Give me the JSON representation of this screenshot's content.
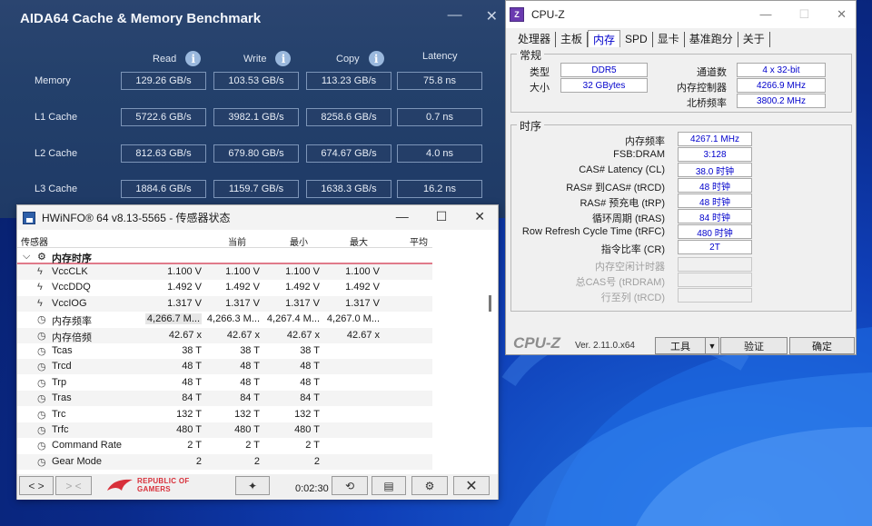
{
  "aida": {
    "title": "AIDA64 Cache & Memory Benchmark",
    "columns": [
      "Read",
      "Write",
      "Copy",
      "Latency"
    ],
    "rows": [
      {
        "label": "Memory",
        "values": [
          "129.26 GB/s",
          "103.53 GB/s",
          "113.23 GB/s",
          "75.8 ns"
        ]
      },
      {
        "label": "L1 Cache",
        "values": [
          "5722.6 GB/s",
          "3982.1 GB/s",
          "8258.6 GB/s",
          "0.7 ns"
        ]
      },
      {
        "label": "L2 Cache",
        "values": [
          "812.63 GB/s",
          "679.80 GB/s",
          "674.67 GB/s",
          "4.0 ns"
        ]
      },
      {
        "label": "L3 Cache",
        "values": [
          "1884.6 GB/s",
          "1159.7 GB/s",
          "1638.3 GB/s",
          "16.2 ns"
        ]
      }
    ]
  },
  "cpuz": {
    "title": "CPU-Z",
    "tabs": [
      "处理器",
      "主板",
      "内存",
      "SPD",
      "显卡",
      "基准跑分",
      "关于"
    ],
    "active_tab": "内存",
    "general": {
      "group": "常规",
      "type_label": "类型",
      "type": "DDR5",
      "size_label": "大小",
      "size": "32 GBytes",
      "channels_label": "通道数",
      "channels": "4 x 32-bit",
      "mc_label": "内存控制器",
      "mc": "4266.9 MHz",
      "nb_label": "北桥频率",
      "nb": "3800.2 MHz"
    },
    "timings": {
      "group": "时序",
      "items": [
        {
          "label": "内存频率",
          "value": "4267.1 MHz",
          "dim": false
        },
        {
          "label": "FSB:DRAM",
          "value": "3:128",
          "dim": false
        },
        {
          "label": "CAS# Latency (CL)",
          "value": "38.0 时钟",
          "dim": false
        },
        {
          "label": "RAS# 到CAS# (tRCD)",
          "value": "48 时钟",
          "dim": false
        },
        {
          "label": "RAS# 预充电 (tRP)",
          "value": "48 时钟",
          "dim": false
        },
        {
          "label": "循环周期 (tRAS)",
          "value": "84 时钟",
          "dim": false
        },
        {
          "label": "Row Refresh Cycle Time (tRFC)",
          "value": "480 时钟",
          "dim": false
        },
        {
          "label": "指令比率 (CR)",
          "value": "2T",
          "dim": false
        },
        {
          "label": "内存空闲计时器",
          "value": "",
          "dim": true
        },
        {
          "label": "总CAS号 (tRDRAM)",
          "value": "",
          "dim": true
        },
        {
          "label": "行至列 (tRCD)",
          "value": "",
          "dim": true
        }
      ]
    },
    "footer": {
      "brand": "CPU-Z",
      "version": "Ver. 2.11.0.x64",
      "tools": "工具",
      "validate": "验证",
      "ok": "确定"
    }
  },
  "hwinfo": {
    "title": "HWiNFO® 64 v8.13-5565 - 传感器状态",
    "columns": {
      "sensor": "传感器",
      "current": "当前",
      "min": "最小",
      "max": "最大",
      "avg": "平均"
    },
    "group": "内存时序",
    "rows": [
      {
        "icon": "bolt",
        "name": "VccCLK",
        "cur": "1.100 V",
        "min": "1.100 V",
        "max": "1.100 V",
        "avg": "1.100 V"
      },
      {
        "icon": "bolt",
        "name": "VccDDQ",
        "cur": "1.492 V",
        "min": "1.492 V",
        "max": "1.492 V",
        "avg": "1.492 V"
      },
      {
        "icon": "bolt",
        "name": "VccIOG",
        "cur": "1.317 V",
        "min": "1.317 V",
        "max": "1.317 V",
        "avg": "1.317 V"
      },
      {
        "icon": "clock",
        "name": "内存频率",
        "cur": "4,266.7 M...",
        "min": "4,266.3 M...",
        "max": "4,267.4 M...",
        "avg": "4,267.0 M..."
      },
      {
        "icon": "clock",
        "name": "内存倍频",
        "cur": "42.67 x",
        "min": "42.67 x",
        "max": "42.67 x",
        "avg": "42.67 x"
      },
      {
        "icon": "clock",
        "name": "Tcas",
        "cur": "38 T",
        "min": "38 T",
        "max": "38 T",
        "avg": ""
      },
      {
        "icon": "clock",
        "name": "Trcd",
        "cur": "48 T",
        "min": "48 T",
        "max": "48 T",
        "avg": ""
      },
      {
        "icon": "clock",
        "name": "Trp",
        "cur": "48 T",
        "min": "48 T",
        "max": "48 T",
        "avg": ""
      },
      {
        "icon": "clock",
        "name": "Tras",
        "cur": "84 T",
        "min": "84 T",
        "max": "84 T",
        "avg": ""
      },
      {
        "icon": "clock",
        "name": "Trc",
        "cur": "132 T",
        "min": "132 T",
        "max": "132 T",
        "avg": ""
      },
      {
        "icon": "clock",
        "name": "Trfc",
        "cur": "480 T",
        "min": "480 T",
        "max": "480 T",
        "avg": ""
      },
      {
        "icon": "clock",
        "name": "Command Rate",
        "cur": "2 T",
        "min": "2 T",
        "max": "2 T",
        "avg": ""
      },
      {
        "icon": "clock",
        "name": "Gear Mode",
        "cur": "2",
        "min": "2",
        "max": "2",
        "avg": ""
      }
    ],
    "footer": {
      "rog_line1": "REPUBLIC OF",
      "rog_line2": "GAMERS",
      "timer": "0:02:30"
    }
  }
}
